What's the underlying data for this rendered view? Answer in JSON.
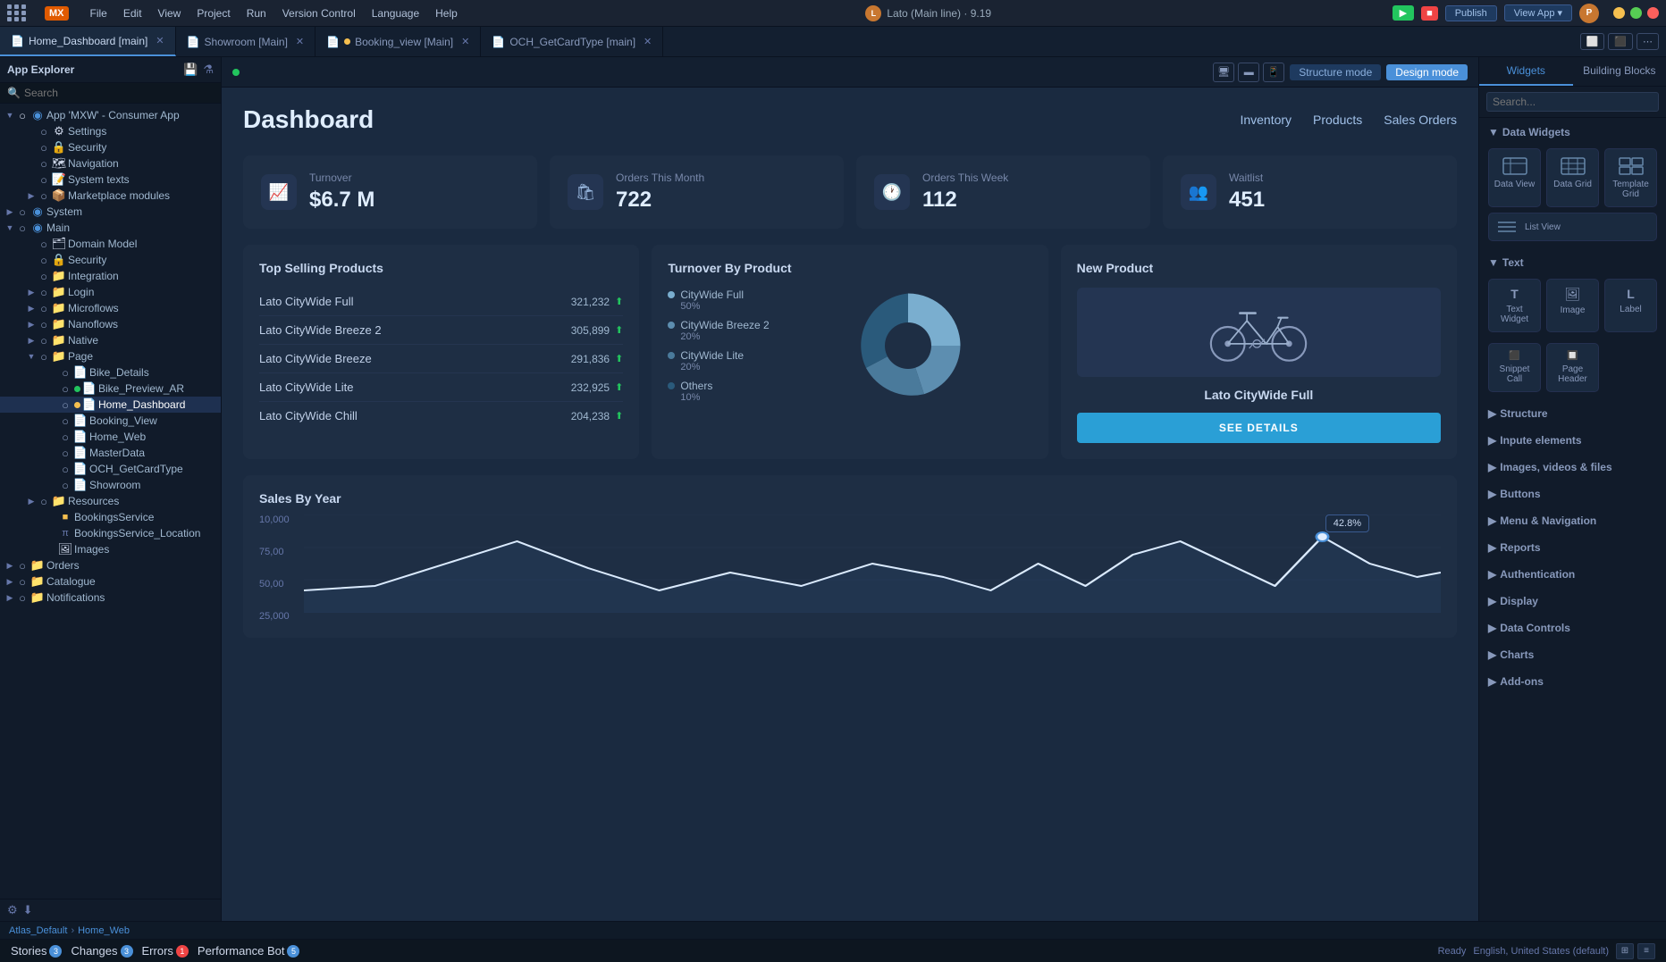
{
  "menuBar": {
    "logo": "MX",
    "items": [
      "File",
      "Edit",
      "View",
      "Project",
      "Run",
      "Version Control",
      "Language",
      "Help"
    ],
    "center": "Lato (Main line) · 9.19",
    "centerIcon": "L",
    "btnRun": "▶",
    "btnStop": "■",
    "btnPublish": "Publish",
    "btnViewApp": "View App",
    "userInitial": "P"
  },
  "tabs": [
    {
      "id": "home-dashboard",
      "label": "Home_Dashboard [main]",
      "active": true,
      "icon": "📄",
      "hasClose": true,
      "hasDot": false
    },
    {
      "id": "showroom",
      "label": "Showroom [Main]",
      "active": false,
      "icon": "📄",
      "hasClose": true,
      "hasDot": false
    },
    {
      "id": "booking-view",
      "label": "Booking_view [Main]",
      "active": false,
      "icon": "📄",
      "hasClose": true,
      "hasDot": true
    },
    {
      "id": "och-getcardtype",
      "label": "OCH_GetCardType [main]",
      "active": false,
      "icon": "📄",
      "hasClose": true,
      "hasDot": false
    }
  ],
  "sidebar": {
    "title": "App Explorer",
    "searchPlaceholder": "Search",
    "tree": [
      {
        "label": "App 'MXW' - Consumer App",
        "indent": 0,
        "expanded": true,
        "icon": "🔷"
      },
      {
        "label": "Settings",
        "indent": 1,
        "icon": "⚙️"
      },
      {
        "label": "Security",
        "indent": 1,
        "icon": "🔒"
      },
      {
        "label": "Navigation",
        "indent": 1,
        "icon": "🗺️"
      },
      {
        "label": "System texts",
        "indent": 1,
        "icon": "📝"
      },
      {
        "label": "Marketplace modules",
        "indent": 1,
        "icon": "📦",
        "expanded": false
      },
      {
        "label": "System",
        "indent": 0,
        "icon": "🔷",
        "expanded": false
      },
      {
        "label": "Main",
        "indent": 0,
        "icon": "🔷",
        "expanded": true
      },
      {
        "label": "Domain Model",
        "indent": 1,
        "icon": "🗂️"
      },
      {
        "label": "Security",
        "indent": 1,
        "icon": "🔒"
      },
      {
        "label": "Integration",
        "indent": 1,
        "icon": "🔗"
      },
      {
        "label": "Login",
        "indent": 1,
        "icon": "📁",
        "expanded": false
      },
      {
        "label": "Microflows",
        "indent": 1,
        "icon": "📁",
        "expanded": false
      },
      {
        "label": "Nanoflows",
        "indent": 1,
        "icon": "📁",
        "expanded": false
      },
      {
        "label": "Native",
        "indent": 1,
        "icon": "📁",
        "expanded": false
      },
      {
        "label": "Page",
        "indent": 1,
        "icon": "📁",
        "expanded": true
      },
      {
        "label": "Bike_Details",
        "indent": 2,
        "icon": "📄"
      },
      {
        "label": "Bike_Preview_AR",
        "indent": 2,
        "icon": "📄",
        "dot": "green"
      },
      {
        "label": "Home_Dashboard",
        "indent": 2,
        "icon": "📄",
        "dot": "yellow",
        "active": true
      },
      {
        "label": "Booking_View",
        "indent": 2,
        "icon": "📄"
      },
      {
        "label": "Home_Web",
        "indent": 2,
        "icon": "📄"
      },
      {
        "label": "MasterData",
        "indent": 2,
        "icon": "📄"
      },
      {
        "label": "OCH_GetCardType",
        "indent": 2,
        "icon": "📄"
      },
      {
        "label": "Showroom",
        "indent": 2,
        "icon": "📄"
      },
      {
        "label": "Resources",
        "indent": 1,
        "icon": "📁",
        "expanded": false
      },
      {
        "label": "BookingsService",
        "indent": 2,
        "icon": "📦"
      },
      {
        "label": "BookingsService_Location",
        "indent": 2,
        "icon": "📦"
      },
      {
        "label": "Images",
        "indent": 2,
        "icon": "🖼️"
      },
      {
        "label": "Orders",
        "indent": 0,
        "icon": "📁",
        "expanded": false
      },
      {
        "label": "Catalogue",
        "indent": 0,
        "icon": "📁",
        "expanded": false
      },
      {
        "label": "Notifications",
        "indent": 0,
        "icon": "📁",
        "expanded": false
      }
    ]
  },
  "canvas": {
    "structureModeLabel": "Structure mode",
    "designModeLabel": "Design mode"
  },
  "dashboard": {
    "title": "Dashboard",
    "nav": [
      "Inventory",
      "Products",
      "Sales Orders"
    ],
    "stats": [
      {
        "label": "Turnover",
        "value": "$6.7 M",
        "icon": "📈"
      },
      {
        "label": "Orders This Month",
        "value": "722",
        "icon": "🛍"
      },
      {
        "label": "Orders This Week",
        "value": "112",
        "icon": "🕐"
      },
      {
        "label": "Waitlist",
        "value": "451",
        "icon": "👥"
      }
    ],
    "topSelling": {
      "title": "Top Selling Products",
      "products": [
        {
          "name": "Lato CityWide Full",
          "sales": "321,232"
        },
        {
          "name": "Lato CityWide Breeze 2",
          "sales": "305,899"
        },
        {
          "name": "Lato CityWide Breeze",
          "sales": "291,836"
        },
        {
          "name": "Lato CityWide Lite",
          "sales": "232,925"
        },
        {
          "name": "Lato CityWide Chill",
          "sales": "204,238"
        }
      ]
    },
    "turnoverByProduct": {
      "title": "Turnover By Product",
      "legend": [
        {
          "label": "CityWide Full",
          "pct": "50%",
          "color": "#7aaecf"
        },
        {
          "label": "CityWide Breeze 2",
          "pct": "20%",
          "color": "#5d8eb0"
        },
        {
          "label": "CityWide Lite",
          "pct": "20%",
          "color": "#4a7a9b"
        },
        {
          "label": "Others",
          "pct": "10%",
          "color": "#2a5a7b"
        }
      ]
    },
    "newProduct": {
      "title": "New Product",
      "name": "Lato CityWide Full",
      "btnLabel": "SEE DETAILS"
    },
    "salesByYear": {
      "title": "Sales By Year",
      "tooltip": "42.8%",
      "yLabels": [
        "10,000",
        "75,00",
        "50,00",
        "25,000"
      ]
    }
  },
  "toolbox": {
    "tabs": [
      "Widgets",
      "Building Blocks"
    ],
    "searchPlaceholder": "Search...",
    "sections": [
      {
        "title": "Data Widgets",
        "widgets": [
          {
            "label": "Data View",
            "icon": "dv"
          },
          {
            "label": "Data Grid",
            "icon": "dg"
          },
          {
            "label": "Template Grid",
            "icon": "tg"
          },
          {
            "label": "List View",
            "icon": "lv"
          }
        ]
      },
      {
        "title": "Text",
        "items": [
          {
            "label": "Text Widget",
            "icon": "T"
          },
          {
            "label": "Image",
            "icon": "img"
          },
          {
            "label": "Label",
            "icon": "L"
          },
          {
            "label": "Snippet Call",
            "icon": "sc"
          },
          {
            "label": "Page Header",
            "icon": "ph"
          }
        ]
      },
      {
        "title": "Structure",
        "items": []
      },
      {
        "title": "Inpute elements",
        "items": []
      },
      {
        "title": "Images, videos & files",
        "items": []
      },
      {
        "title": "Buttons",
        "items": []
      },
      {
        "title": "Menu & Navigation",
        "items": []
      },
      {
        "title": "Reports",
        "items": []
      },
      {
        "title": "Authentication",
        "items": []
      },
      {
        "title": "Display",
        "items": []
      },
      {
        "title": "Data Controls",
        "items": []
      },
      {
        "title": "Charts",
        "items": []
      },
      {
        "title": "Add-ons",
        "items": []
      }
    ]
  },
  "statusBar": {
    "stories": {
      "label": "Stories",
      "count": "3"
    },
    "changes": {
      "label": "Changes",
      "count": "3"
    },
    "errors": {
      "label": "Errors",
      "count": "1",
      "type": "red"
    },
    "performanceBot": {
      "label": "Performance Bot",
      "count": "5"
    }
  },
  "bottomBar": {
    "status": "Ready",
    "locale": "English, United States (default)"
  },
  "breadcrumb": {
    "root": "Atlas_Default",
    "separator": "›",
    "path": "Home_Web"
  }
}
